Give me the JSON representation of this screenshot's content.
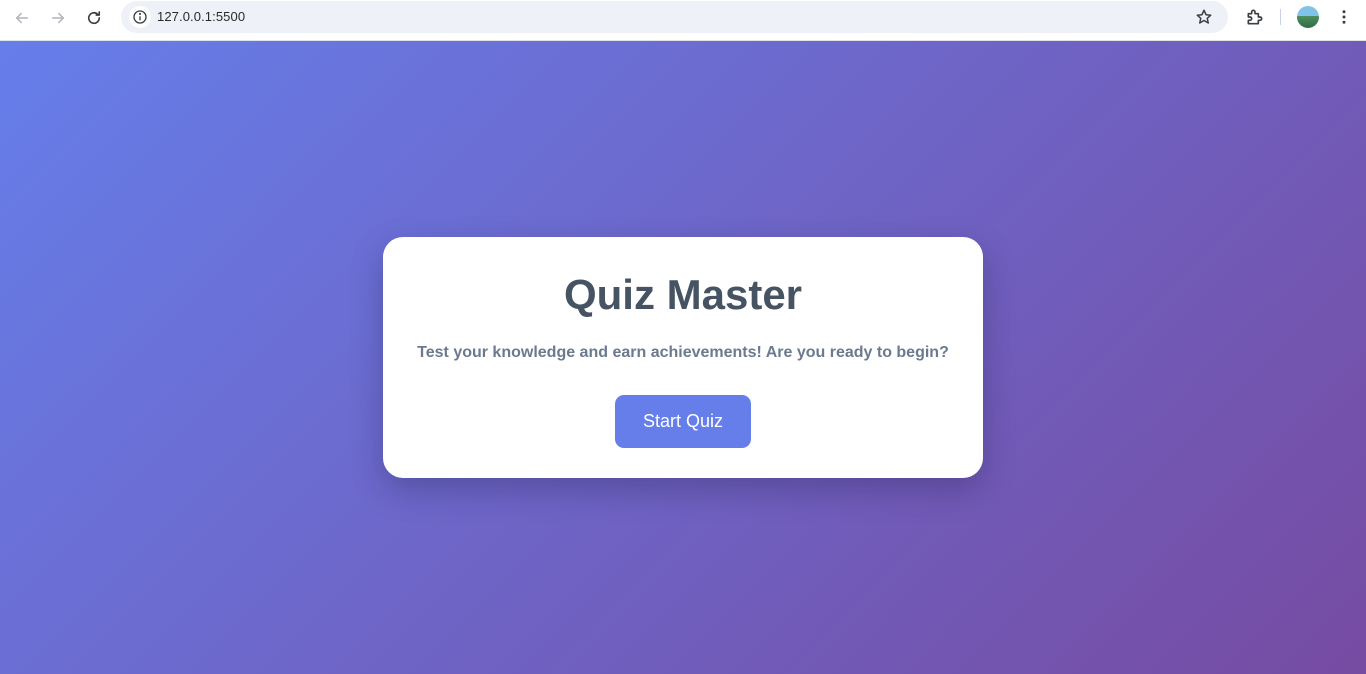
{
  "browser": {
    "url": "127.0.0.1:5500"
  },
  "page": {
    "title": "Quiz Master",
    "subtitle": "Test your knowledge and earn achievements! Are you ready to begin?",
    "start_button_label": "Start Quiz"
  },
  "icons": {
    "back": "arrow-left-icon",
    "forward": "arrow-right-icon",
    "reload": "reload-icon",
    "site_info": "info-icon",
    "bookmark": "star-icon",
    "extensions": "puzzle-icon",
    "profile": "avatar",
    "menu": "kebab-menu-icon"
  },
  "colors": {
    "gradient_start": "#667eea",
    "gradient_end": "#764ba2",
    "button": "#667eea",
    "title": "#465363",
    "subtitle": "#6b7a8f"
  }
}
